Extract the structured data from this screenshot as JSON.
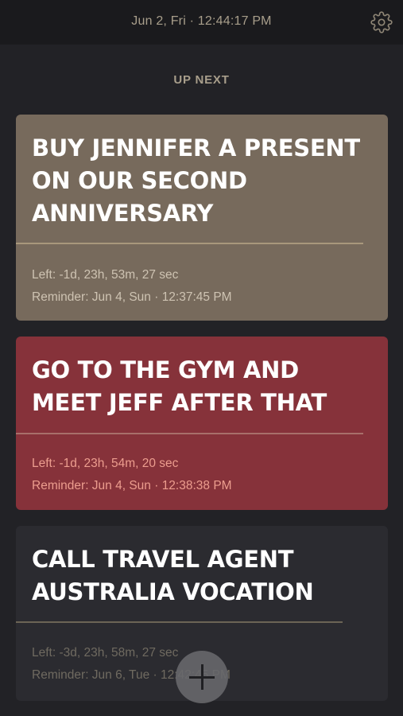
{
  "header": {
    "datetime": "Jun 2, Fri · 12:44:17 PM",
    "settings_icon": "gear-icon"
  },
  "section": {
    "label": "UP NEXT"
  },
  "reminders": [
    {
      "title": "BUY JENNIFER A PRESENT ON OUR SECOND ANNIVERSARY",
      "left": "Left: -1d, 23h, 53m, 27 sec",
      "reminder": "Reminder: Jun 4, Sun · 12:37:45 PM",
      "color": "#776a5c"
    },
    {
      "title": "GO TO THE GYM AND MEET JEFF AFTER THAT",
      "left": "Left: -1d, 23h, 54m, 20 sec",
      "reminder": "Reminder: Jun 4, Sun · 12:38:38 PM",
      "color": "#86323a"
    },
    {
      "title": "CALL TRAVEL AGENT AUSTRALIA VOCATION",
      "left": "Left: -3d, 23h, 58m, 27 sec",
      "reminder": "Reminder: Jun 6, Tue · 12:42:45 PM",
      "color": "#2b2b30"
    }
  ],
  "fab": {
    "icon": "plus-icon"
  }
}
